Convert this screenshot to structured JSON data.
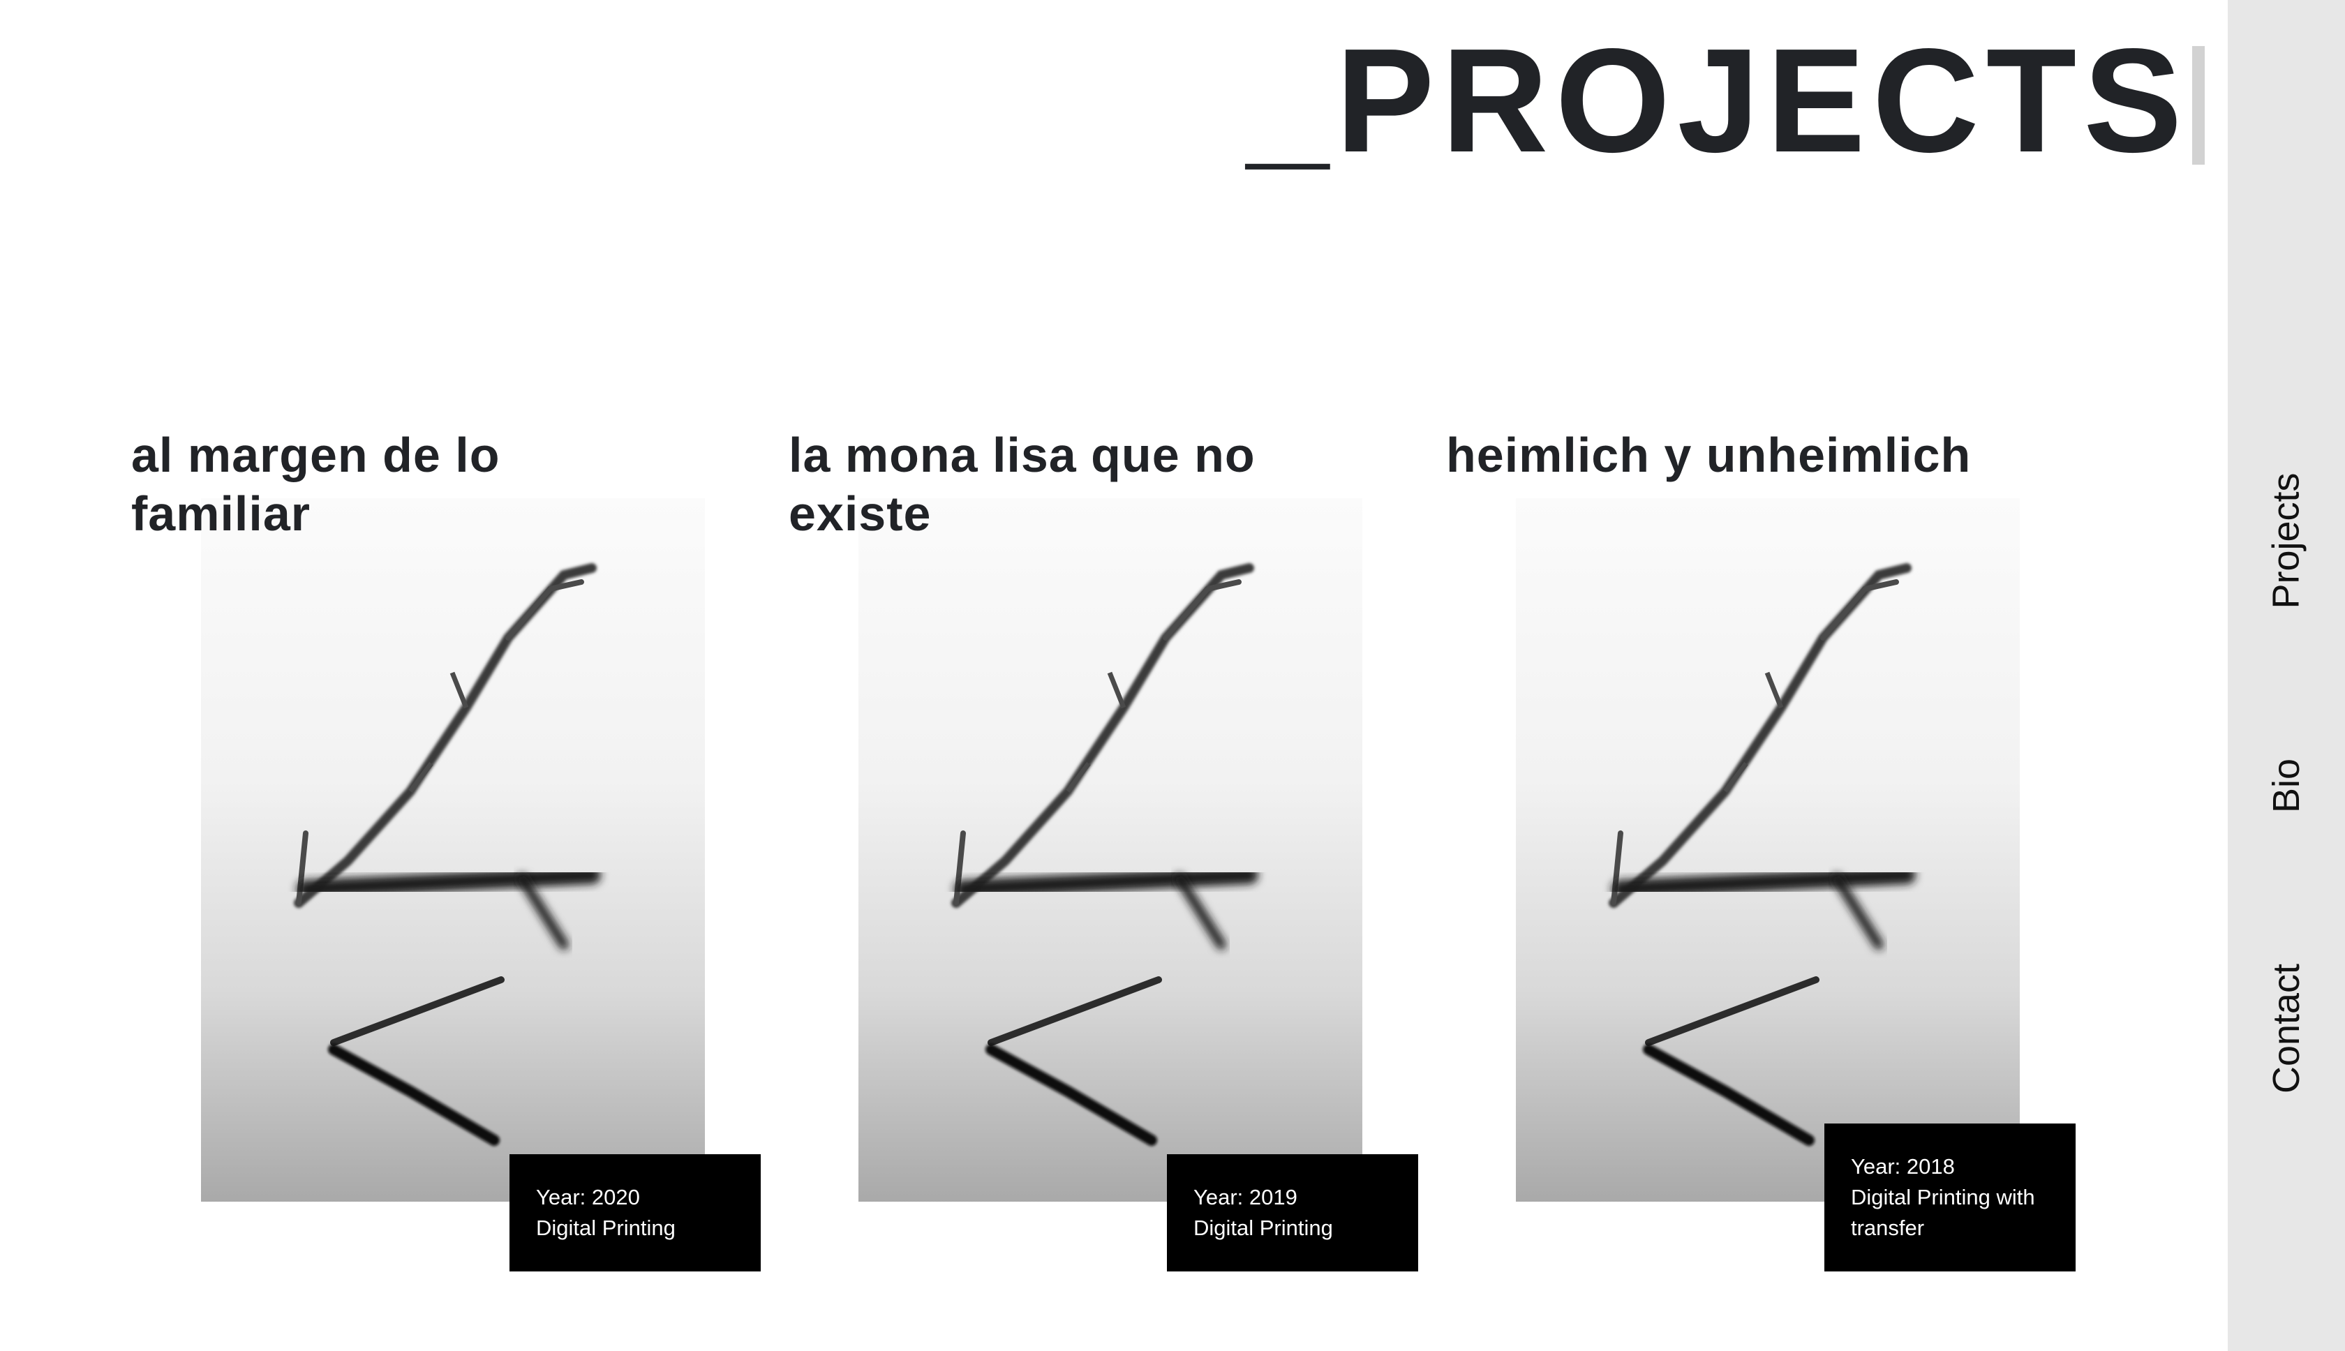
{
  "header": {
    "title": "_PROJECTS"
  },
  "sidebar": {
    "items": [
      {
        "label": "Projects"
      },
      {
        "label": "Bio"
      },
      {
        "label": "Contact"
      }
    ]
  },
  "projects": [
    {
      "title": "al margen de lo familiar",
      "year": "Year: 2020",
      "technique": "Digital Printing"
    },
    {
      "title": "la mona lisa que no existe",
      "year": "Year: 2019",
      "technique": "Digital Printing"
    },
    {
      "title": "heimlich y unheimlich",
      "year": "Year: 2018",
      "technique": "Digital Printing with transfer"
    }
  ],
  "colors": {
    "text": "#212327",
    "sidebar_bg": "#e7e7e7",
    "info_box_bg": "#000000",
    "caret": "#d2d2d2"
  },
  "icons": {
    "project_image": "branch-reflection-photo"
  }
}
